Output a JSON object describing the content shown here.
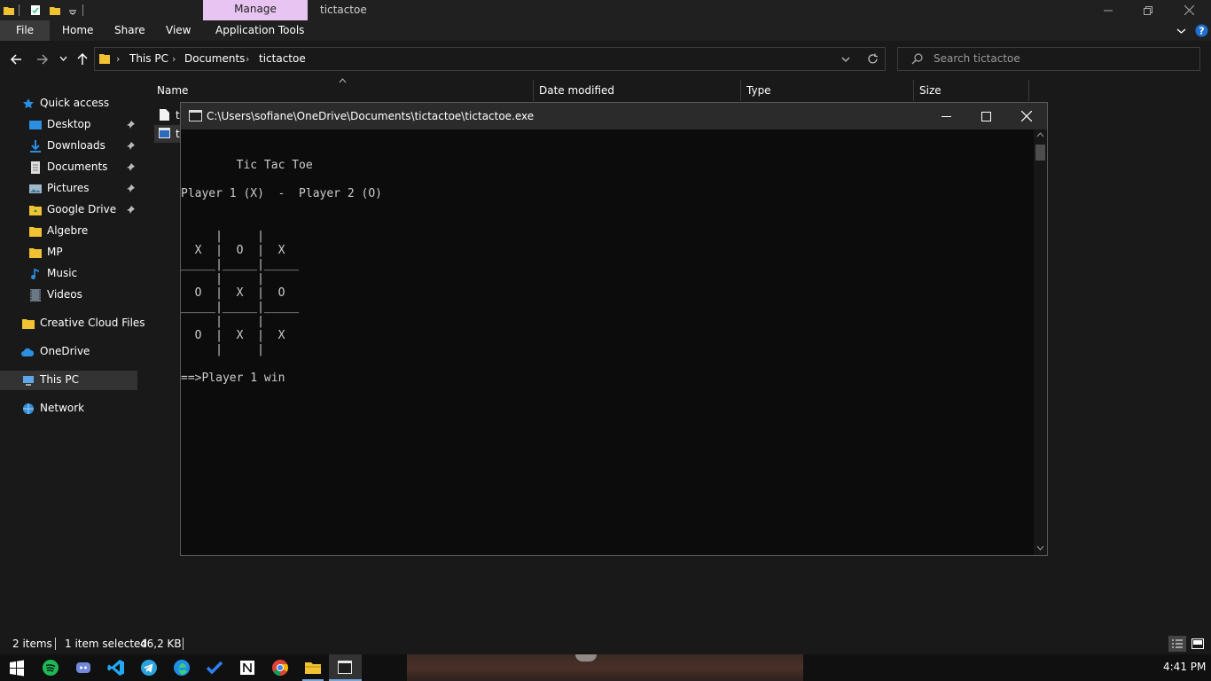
{
  "titlebar": {
    "manage_tab": "Manage",
    "window_title": "tictactoe"
  },
  "ribbon": {
    "tabs": [
      "File",
      "Home",
      "Share",
      "View",
      "Application Tools"
    ]
  },
  "address": {
    "crumbs": [
      "This PC",
      "Documents",
      "tictactoe"
    ],
    "search_placeholder": "Search tictactoe"
  },
  "nav": {
    "quick_access": "Quick access",
    "items": [
      "Desktop",
      "Downloads",
      "Documents",
      "Pictures",
      "Google Drive",
      "Algebre",
      "MP",
      "Music",
      "Videos"
    ],
    "creative_cloud": "Creative Cloud Files",
    "onedrive": "OneDrive",
    "this_pc": "This PC",
    "network": "Network"
  },
  "columns": [
    "Name",
    "Date modified",
    "Type",
    "Size"
  ],
  "files": [
    {
      "name_visible": "t"
    },
    {
      "name_visible": "t"
    }
  ],
  "console": {
    "title": "C:\\Users\\sofiane\\OneDrive\\Documents\\tictactoe\\tictactoe.exe",
    "lines": [
      "",
      "        Tic Tac Toe",
      "",
      "Player 1 (X)  -  Player 2 (O)",
      "",
      "",
      "",
      "     |     |",
      "  X  |  O  |  X",
      "_____|_____|_____",
      "     |     |",
      "  O  |  X  |  O",
      "_____|_____|_____",
      "     |     |",
      "  O  |  X  |  X",
      "     |     |",
      "",
      "==>Player 1 win"
    ]
  },
  "status": {
    "items_count": "2 items",
    "selected": "1 item selected",
    "size": "46,2 KB"
  },
  "taskbar": {
    "clock": "4:41 PM",
    "icons": [
      "windows-start",
      "spotify",
      "discord",
      "vscode",
      "telegram",
      "edge",
      "todo",
      "notion",
      "chrome",
      "file-explorer",
      "console-app"
    ]
  },
  "colors": {
    "manage_accent": "#e8c4f2",
    "background": "#191919",
    "console_bg": "#0c0c0c",
    "console_text": "#cccccc"
  }
}
